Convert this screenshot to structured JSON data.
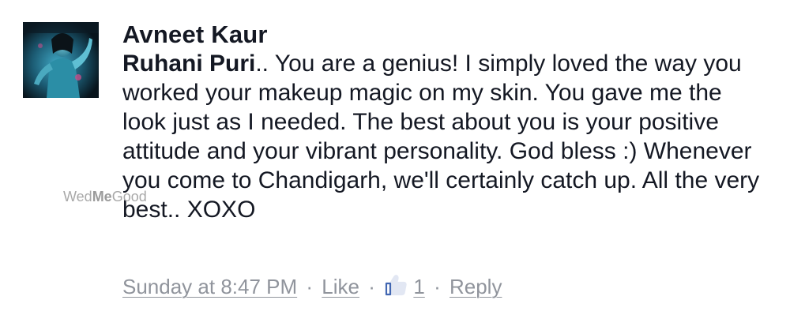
{
  "comment": {
    "author": "Avneet Kaur",
    "mention": "Ruhani Puri",
    "text": ".. You are a genius! I simply loved the way you worked your makeup magic on my skin. You gave me the look just as I needed. The best about you is your positive attitude and your vibrant personality. God bless :) Whenever you come to Chandigarh, we'll certainly catch up. All the very best.. XOXO"
  },
  "actions": {
    "timestamp": "Sunday at 8:47 PM",
    "like_label": "Like",
    "like_count": "1",
    "reply_label": "Reply",
    "separator": "·"
  },
  "watermark": {
    "part1": "Wed",
    "part2": "Me",
    "part3": "Good"
  },
  "colors": {
    "text": "#141823",
    "meta": "#90949c",
    "like_blue": "#4267b2"
  },
  "icons": {
    "avatar": "profile-photo",
    "like": "thumbs-up-icon"
  }
}
